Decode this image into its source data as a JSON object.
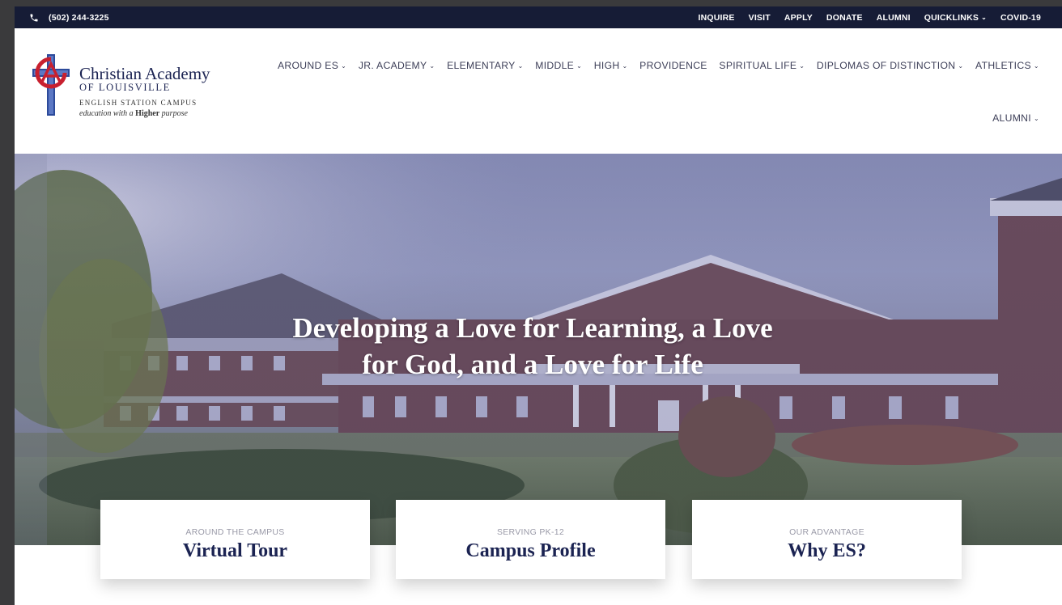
{
  "topbar": {
    "phone": "(502) 244-3225",
    "links": [
      "INQUIRE",
      "VISIT",
      "APPLY",
      "DONATE",
      "ALUMNI",
      "QUICKLINKS",
      "COVID-19"
    ]
  },
  "logo": {
    "name": "Christian Academy",
    "sub": "OF LOUISVILLE",
    "campus": "ENGLISH STATION CAMPUS",
    "tag_pre": "education with a",
    "tag_bold": "Higher",
    "tag_post": "purpose"
  },
  "nav": {
    "items": [
      {
        "label": "AROUND ES",
        "dropdown": true
      },
      {
        "label": "JR. ACADEMY",
        "dropdown": true
      },
      {
        "label": "ELEMENTARY",
        "dropdown": true
      },
      {
        "label": "MIDDLE",
        "dropdown": true
      },
      {
        "label": "HIGH",
        "dropdown": true
      },
      {
        "label": "PROVIDENCE",
        "dropdown": false
      },
      {
        "label": "SPIRITUAL LIFE",
        "dropdown": true
      },
      {
        "label": "DIPLOMAS OF DISTINCTION",
        "dropdown": true
      },
      {
        "label": "ATHLETICS",
        "dropdown": true
      }
    ],
    "alumni": "ALUMNI"
  },
  "hero": {
    "title_line1": "Developing a Love for Learning, a Love",
    "title_line2": "for God, and a Love for Life"
  },
  "cards": [
    {
      "kicker": "AROUND THE CAMPUS",
      "title": "Virtual Tour"
    },
    {
      "kicker": "SERVING PK-12",
      "title": "Campus Profile"
    },
    {
      "kicker": "OUR ADVANTAGE",
      "title": "Why ES?"
    }
  ],
  "colors": {
    "topbar": "#161c36",
    "brand_navy": "#1b2352",
    "nav_text": "#3d3f58",
    "logo_red": "#c8202f",
    "logo_blue": "#2c4a9a"
  }
}
